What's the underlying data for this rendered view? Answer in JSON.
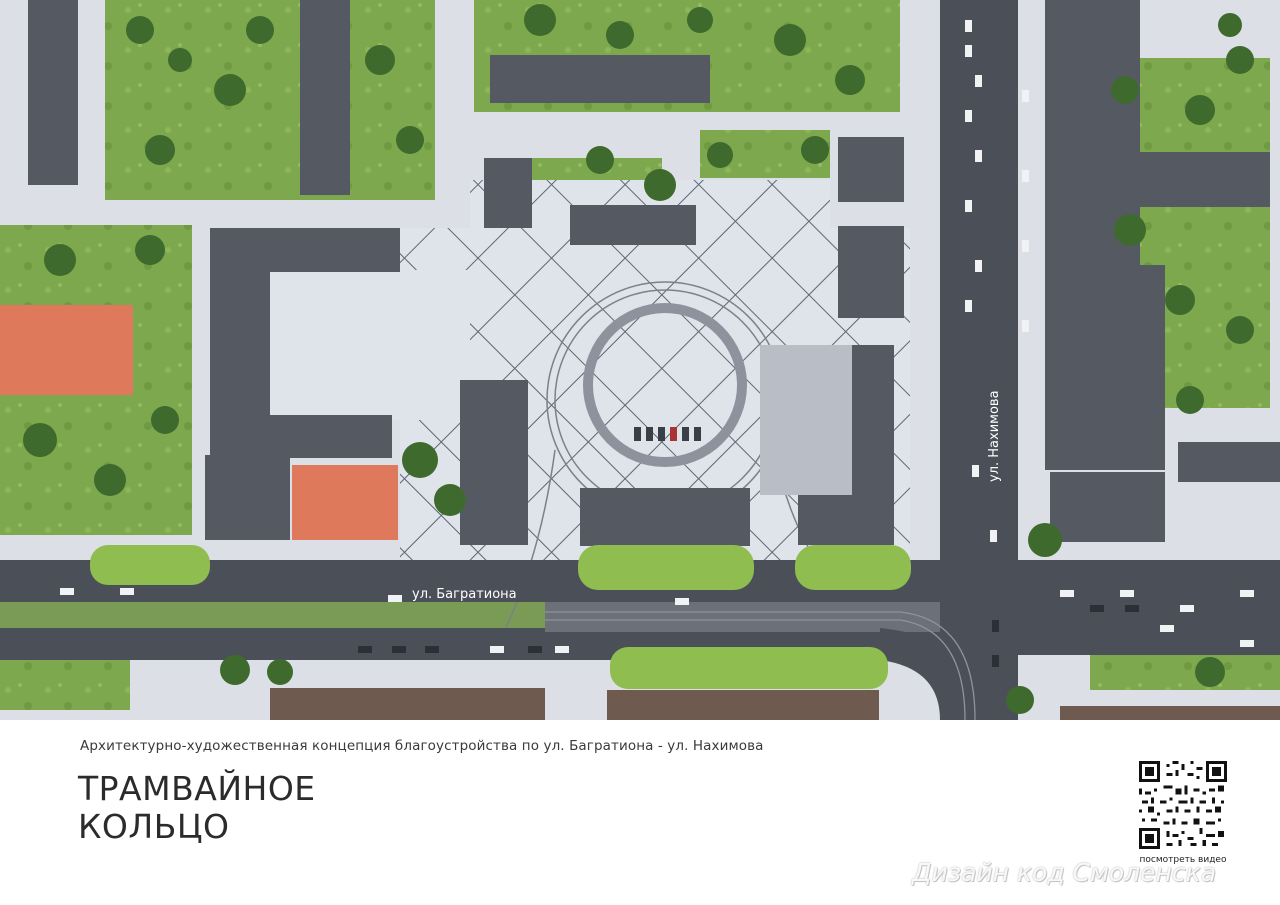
{
  "map": {
    "street_labels": {
      "bagrationa": "ул. Багратиона",
      "nakhimova": "ул. Нахимова"
    }
  },
  "caption": {
    "subtitle": "Архитектурно-художественная концепция благоустройства по ул. Багратиона - ул. Нахимова",
    "title_line1": "ТРАМВАЙНОЕ",
    "title_line2": "КОЛЬЦО"
  },
  "qr": {
    "label": "посмотреть видео"
  },
  "watermark": "Дизайн код Смоленска",
  "colors": {
    "road": "#4a4f58",
    "plaza": "#dfe2e8",
    "roof_dark": "#555a62",
    "roof_orange": "#e07a5a",
    "lawn": "#7aa84a",
    "tree": "#3d6b2c"
  }
}
